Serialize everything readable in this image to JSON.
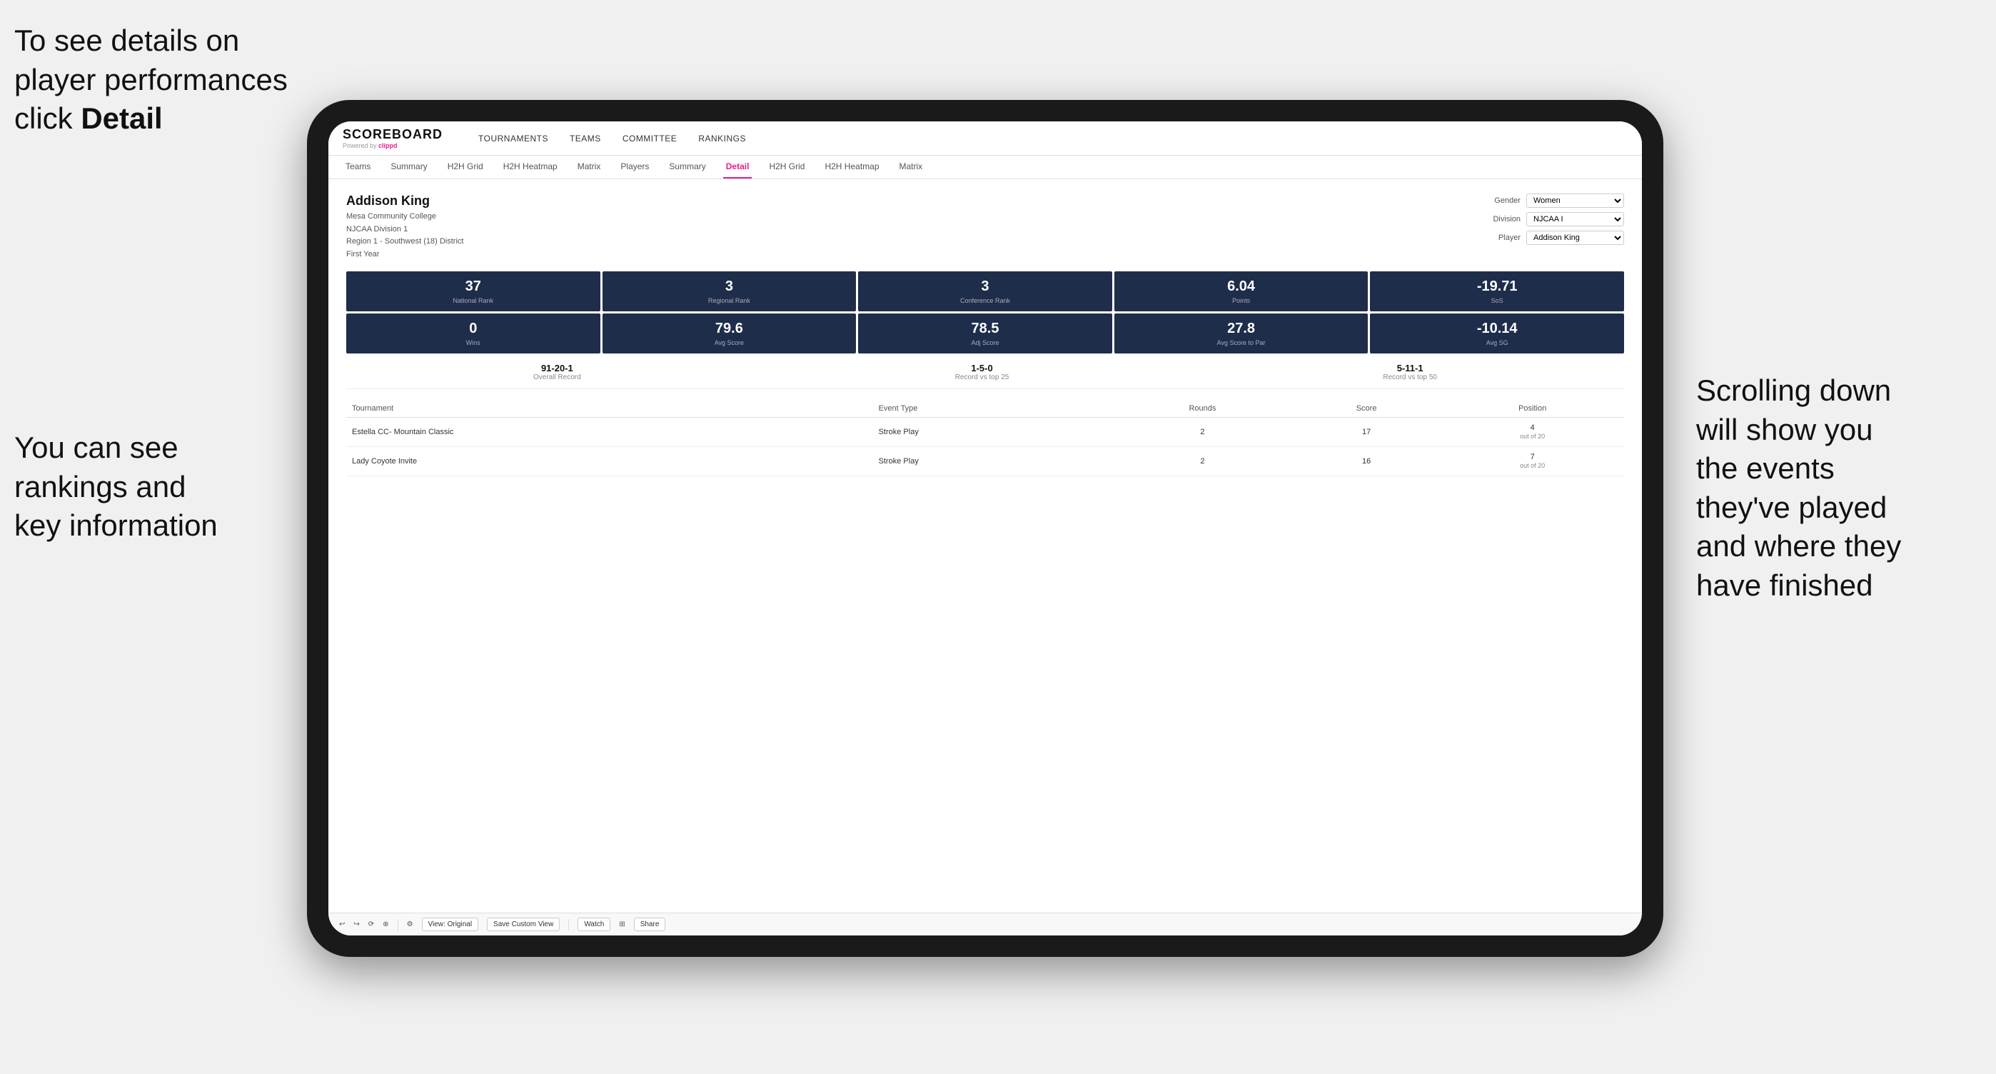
{
  "annotations": {
    "top_left": "To see details on player performances click ",
    "top_left_bold": "Detail",
    "bottom_left_line1": "You can see",
    "bottom_left_line2": "rankings and",
    "bottom_left_line3": "key information",
    "right_line1": "Scrolling down",
    "right_line2": "will show you",
    "right_line3": "the events",
    "right_line4": "they've played",
    "right_line5": "and where they",
    "right_line6": "have finished"
  },
  "nav": {
    "logo": "SCOREBOARD",
    "powered_by": "Powered by ",
    "clippd": "clippd",
    "items": [
      "TOURNAMENTS",
      "TEAMS",
      "COMMITTEE",
      "RANKINGS"
    ]
  },
  "sub_nav": {
    "items": [
      "Teams",
      "Summary",
      "H2H Grid",
      "H2H Heatmap",
      "Matrix",
      "Players",
      "Summary",
      "Detail",
      "H2H Grid",
      "H2H Heatmap",
      "Matrix"
    ],
    "active": "Detail"
  },
  "player": {
    "name": "Addison King",
    "college": "Mesa Community College",
    "division": "NJCAA Division 1",
    "region": "Region 1 - Southwest (18) District",
    "year": "First Year"
  },
  "filters": {
    "gender_label": "Gender",
    "gender_value": "Women",
    "division_label": "Division",
    "division_value": "NJCAA I",
    "player_label": "Player",
    "player_value": "Addison King"
  },
  "stats_row1": [
    {
      "value": "37",
      "label": "National Rank"
    },
    {
      "value": "3",
      "label": "Regional Rank"
    },
    {
      "value": "3",
      "label": "Conference Rank"
    },
    {
      "value": "6.04",
      "label": "Points"
    },
    {
      "value": "-19.71",
      "label": "SoS"
    }
  ],
  "stats_row2": [
    {
      "value": "0",
      "label": "Wins"
    },
    {
      "value": "79.6",
      "label": "Avg Score"
    },
    {
      "value": "78.5",
      "label": "Adj Score"
    },
    {
      "value": "27.8",
      "label": "Avg Score to Par"
    },
    {
      "value": "-10.14",
      "label": "Avg SG"
    }
  ],
  "records": [
    {
      "value": "91-20-1",
      "label": "Overall Record"
    },
    {
      "value": "1-5-0",
      "label": "Record vs top 25"
    },
    {
      "value": "5-11-1",
      "label": "Record vs top 50"
    }
  ],
  "table": {
    "headers": [
      "Tournament",
      "Event Type",
      "Rounds",
      "Score",
      "Position"
    ],
    "rows": [
      {
        "tournament": "Estella CC- Mountain Classic",
        "event_type": "Stroke Play",
        "rounds": "2",
        "score": "17",
        "position": "4",
        "position_detail": "out of 20"
      },
      {
        "tournament": "Lady Coyote Invite",
        "event_type": "Stroke Play",
        "rounds": "2",
        "score": "16",
        "position": "7",
        "position_detail": "out of 20"
      }
    ]
  },
  "toolbar": {
    "view_original": "View: Original",
    "save_custom": "Save Custom View",
    "watch": "Watch",
    "share": "Share"
  }
}
